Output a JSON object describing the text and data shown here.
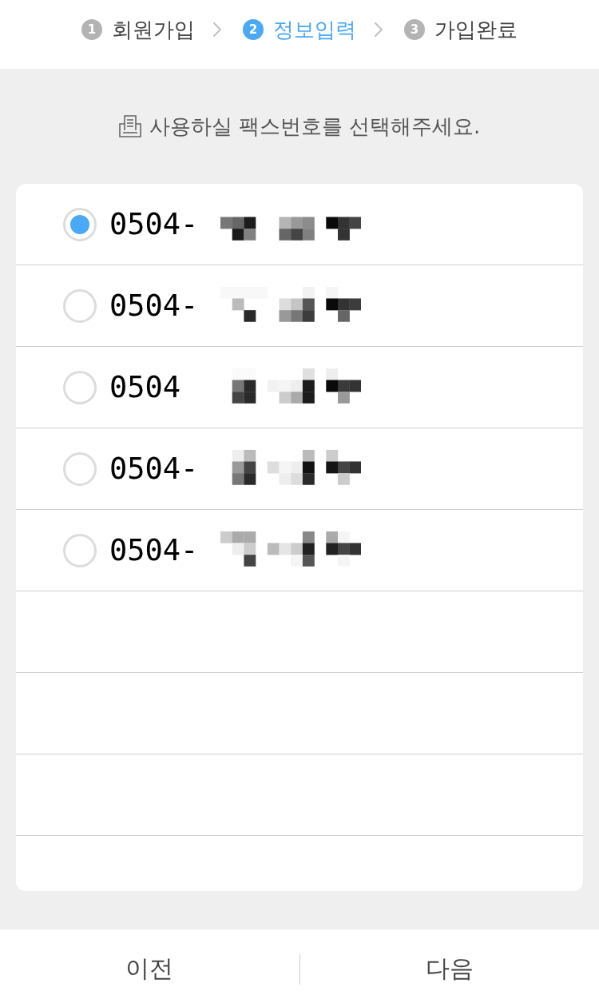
{
  "steps": [
    {
      "number": "1",
      "label": "회원가입",
      "selected": false
    },
    {
      "number": "2",
      "label": "정보입력",
      "selected": true
    },
    {
      "number": "3",
      "label": "가입완료",
      "selected": false
    }
  ],
  "instruction": {
    "text": "사용하실 팩스번호를 선택해주세요."
  },
  "numbers": [
    {
      "prefix": "0504-",
      "selected": true
    },
    {
      "prefix": "0504-",
      "selected": false
    },
    {
      "prefix": "0504",
      "selected": false
    },
    {
      "prefix": "0504-",
      "selected": false
    },
    {
      "prefix": "0504-",
      "selected": false
    }
  ],
  "footer": {
    "buttons": [
      {
        "label": "이전"
      },
      {
        "label": "다음"
      }
    ]
  }
}
